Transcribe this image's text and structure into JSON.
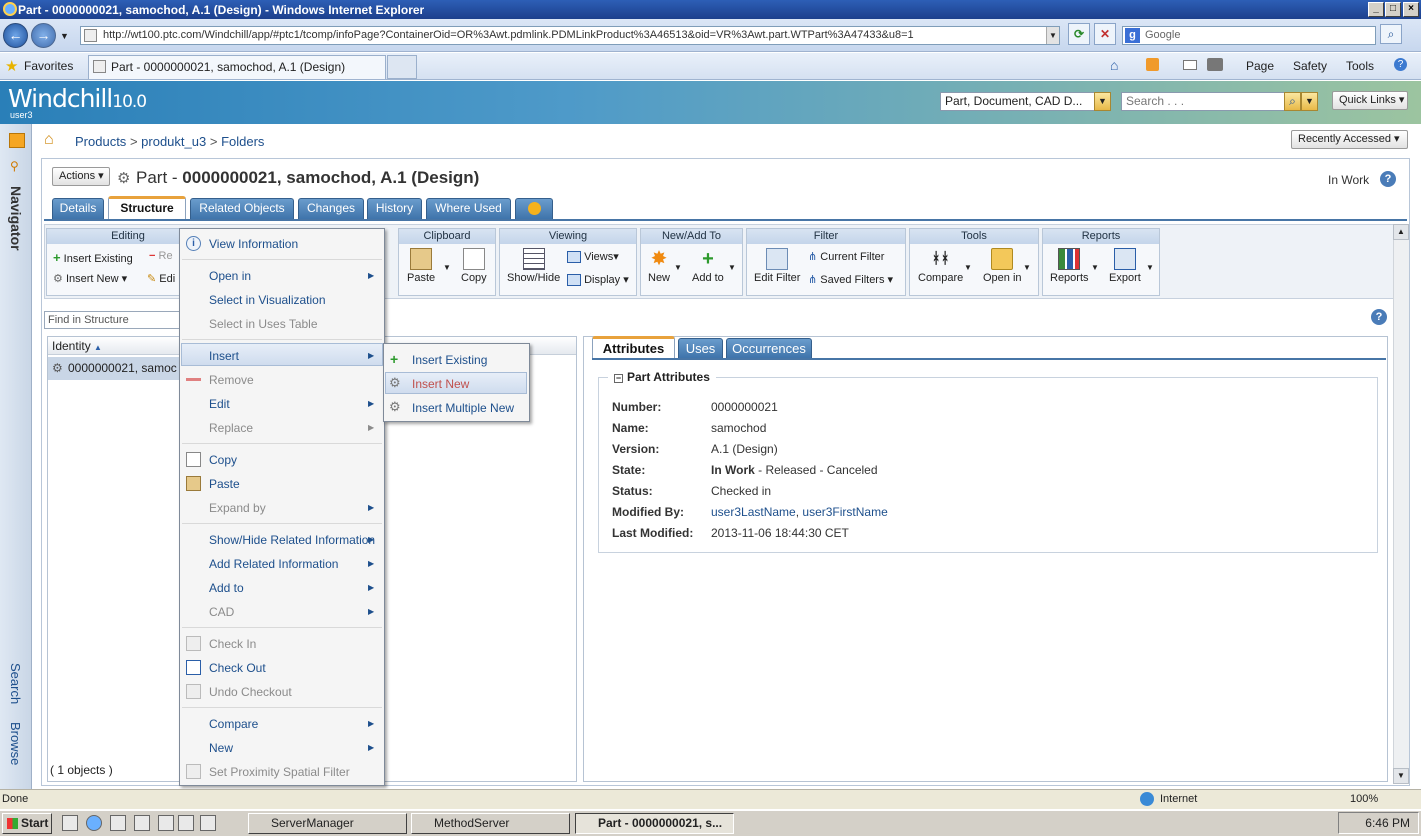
{
  "window": {
    "title": "Part - 0000000021, samochod, A.1 (Design) - Windows Internet Explorer",
    "address": "http://wt100.ptc.com/Windchill/app/#ptc1/tcomp/infoPage?ContainerOid=OR%3Awt.pdmlink.PDMLinkProduct%3A46513&oid=VR%3Awt.part.WTPart%3A47433&u8=1",
    "search_engine": "Google",
    "favorites_label": "Favorites",
    "tab_title": "Part - 0000000021, samochod, A.1 (Design)",
    "commands": [
      "Page",
      "Safety",
      "Tools"
    ]
  },
  "app": {
    "logo": "Windchill",
    "version": "10.0",
    "user": "user3",
    "search_type": "Part, Document, CAD D...",
    "search_placeholder": "Search . . .",
    "quick_links": "Quick Links",
    "recently_accessed": "Recently Accessed"
  },
  "navigator": {
    "title": "Navigator",
    "search": "Search",
    "browse": "Browse"
  },
  "breadcrumb": {
    "items": [
      "Products",
      "produkt_u3",
      "Folders"
    ],
    "sep": ">"
  },
  "page": {
    "actions_label": "Actions",
    "title_prefix": "Part - ",
    "title": "0000000021, samochod, A.1 (Design)",
    "state": "In Work",
    "tabs": [
      "Details",
      "Structure",
      "Related Objects",
      "Changes",
      "History",
      "Where Used"
    ],
    "selected_tab": "Structure"
  },
  "toolbar": {
    "editing": {
      "header": "Editing",
      "insert_existing": "Insert Existing",
      "insert_new": "Insert New",
      "edit_partial": "Edi",
      "remove_partial": "Re"
    },
    "clipboard": {
      "header": "Clipboard",
      "paste": "Paste",
      "copy": "Copy"
    },
    "viewing": {
      "header": "Viewing",
      "show_hide": "Show/Hide",
      "views": "Views",
      "display": "Display"
    },
    "new_add": {
      "header": "New/Add To",
      "new": "New",
      "add_to": "Add to"
    },
    "filter": {
      "header": "Filter",
      "edit_filter": "Edit Filter",
      "current_filter": "Current Filter",
      "saved_filters": "Saved Filters"
    },
    "tools": {
      "header": "Tools",
      "compare": "Compare",
      "open_in": "Open in"
    },
    "reports": {
      "header": "Reports",
      "reports": "Reports",
      "export": "Export"
    }
  },
  "tree": {
    "find_placeholder": "Find in Structure",
    "column": "Identity",
    "row": "0000000021, samoc",
    "count": "( 1 objects )"
  },
  "attributes": {
    "tabs": [
      "Attributes",
      "Uses",
      "Occurrences"
    ],
    "section_title": "Part Attributes",
    "labels": {
      "number": "Number:",
      "name": "Name:",
      "version": "Version:",
      "state": "State:",
      "status": "Status:",
      "modified_by": "Modified By:",
      "last_modified": "Last Modified:"
    },
    "values": {
      "number": "0000000021",
      "name": "samochod",
      "version": "A.1 (Design)",
      "state_current": "In Work",
      "state_rest": " - Released - Canceled",
      "status": "Checked in",
      "modified_by_last": "user3LastName",
      "modified_by_first": "user3FirstName",
      "last_modified": "2013-11-06 18:44:30 CET"
    }
  },
  "context_menu": {
    "view_information": "View Information",
    "open_in": "Open in",
    "select_in_visualization": "Select in Visualization",
    "select_in_uses_table": "Select in Uses Table",
    "insert": "Insert",
    "remove": "Remove",
    "edit": "Edit",
    "replace": "Replace",
    "copy": "Copy",
    "paste": "Paste",
    "expand_by": "Expand by",
    "show_hide_related": "Show/Hide Related Information",
    "add_related": "Add Related Information",
    "add_to": "Add to",
    "cad": "CAD",
    "check_in": "Check In",
    "check_out": "Check Out",
    "undo_checkout": "Undo Checkout",
    "compare": "Compare",
    "new": "New",
    "set_proximity": "Set Proximity Spatial Filter"
  },
  "insert_submenu": {
    "insert_existing": "Insert Existing",
    "insert_new": "Insert New",
    "insert_multiple_new": "Insert Multiple New"
  },
  "statusbar": {
    "text": "Done",
    "zone": "Internet",
    "zoom": "100%"
  },
  "taskbar": {
    "start": "Start",
    "tasks": [
      "ServerManager",
      "MethodServer",
      "Part - 0000000021, s..."
    ],
    "clock": "6:46 PM"
  },
  "colors": {
    "link": "#1d4f8c",
    "tab_blue": "#3f74ab",
    "accent_orange": "#e8a23c"
  }
}
